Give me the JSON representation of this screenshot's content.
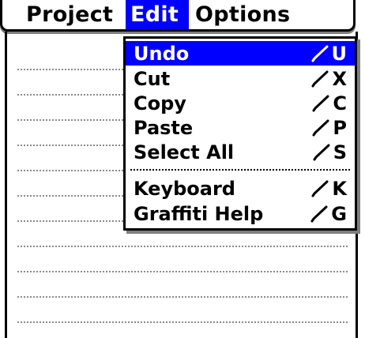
{
  "menubar": {
    "tabs": [
      {
        "label": "Project",
        "selected": false
      },
      {
        "label": "Edit",
        "selected": true
      },
      {
        "label": "Options",
        "selected": false
      }
    ]
  },
  "dropdown": {
    "items": [
      {
        "label": "Undo",
        "shortcut": "U",
        "highlighted": true
      },
      {
        "label": "Cut",
        "shortcut": "X"
      },
      {
        "label": "Copy",
        "shortcut": "C"
      },
      {
        "label": "Paste",
        "shortcut": "P"
      },
      {
        "label": "Select All",
        "shortcut": "S"
      },
      {
        "label": "Keyboard",
        "shortcut": "K"
      },
      {
        "label": "Graffiti Help",
        "shortcut": "G"
      }
    ],
    "command_stroke_icon": "graffiti-command-stroke-icon"
  },
  "colors": {
    "selection": "#0000ff",
    "shadow": "#7f7f7f",
    "dotted_line": "#8a8a8a"
  }
}
